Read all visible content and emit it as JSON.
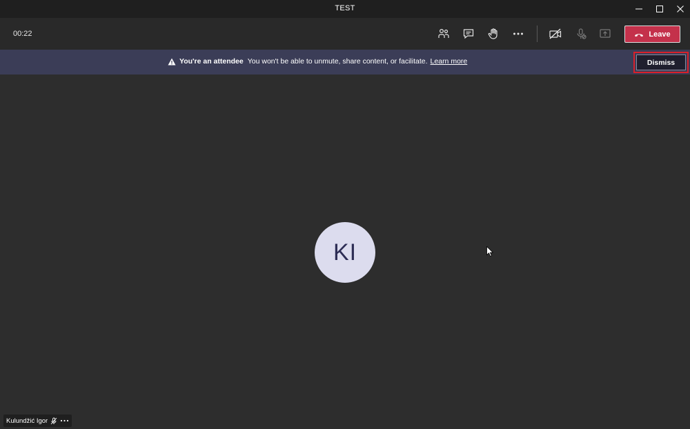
{
  "window": {
    "title": "TEST"
  },
  "toolbar": {
    "timer": "00:22",
    "leave_label": "Leave"
  },
  "banner": {
    "title": "You're an attendee",
    "message": "You won't be able to unmute, share content, or facilitate.",
    "learn_more": "Learn more",
    "dismiss_label": "Dismiss"
  },
  "participant": {
    "initials": "KI",
    "name": "Kulundžić Igor"
  },
  "icons": {
    "toolbar": [
      "people-icon",
      "chat-icon",
      "raise-hand-icon",
      "more-icon",
      "camera-off-icon",
      "mic-off-icon",
      "share-screen-icon",
      "phone-hangup-icon"
    ],
    "window": [
      "minimize-icon",
      "maximize-icon",
      "close-icon"
    ],
    "banner": [
      "warning-icon"
    ],
    "name_tag": [
      "mic-muted-icon",
      "more-icon"
    ]
  },
  "colors": {
    "leave_button": "#c4314b",
    "banner_bg": "#3b3d57",
    "avatar_bg": "#dcdcee",
    "highlight": "#d9202a"
  }
}
